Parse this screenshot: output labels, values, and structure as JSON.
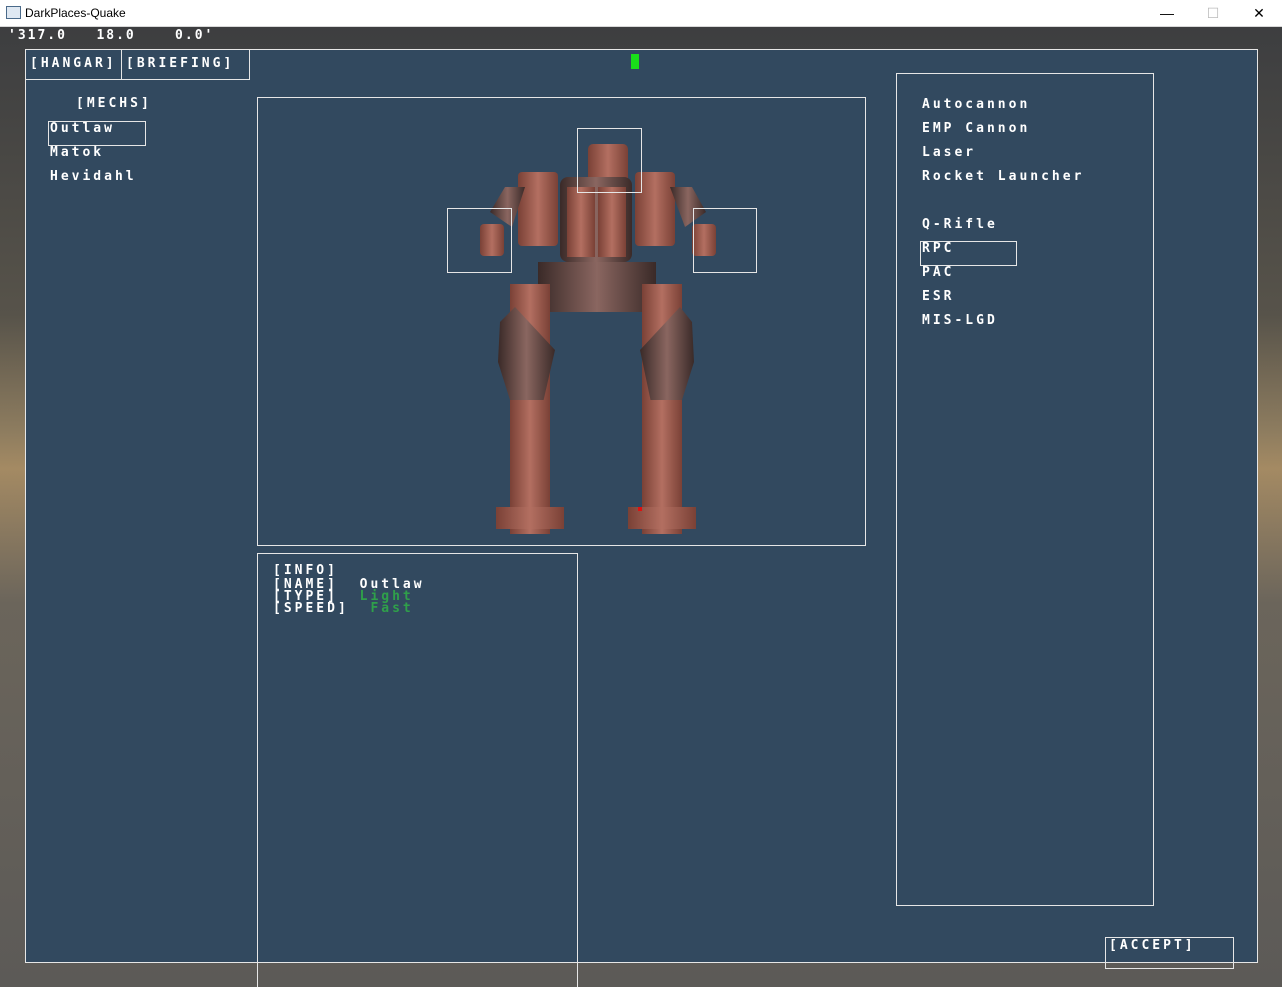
{
  "window": {
    "title": "DarkPlaces-Quake",
    "minimize_glyph": "—",
    "maximize_glyph": "☐",
    "close_glyph": "✕"
  },
  "hud": {
    "coords": "'317.0   18.0    0.0'"
  },
  "tabs": {
    "hangar": "[HANGAR]",
    "briefing": "[BRIEFING]"
  },
  "mechs": {
    "header": "[MECHS]",
    "items": [
      "Outlaw",
      "Matok",
      "Hevidahl"
    ],
    "selected": "Outlaw"
  },
  "weapons": {
    "items": [
      "Autocannon",
      "EMP Cannon",
      "Laser",
      "Rocket Launcher",
      "Q-Rifle",
      "RPC",
      "PAC",
      "ESR",
      "MIS-LGD"
    ],
    "selected": "RPC"
  },
  "info": {
    "header": "[INFO]",
    "name_label": "[NAME]",
    "name_value": "Outlaw",
    "type_label": "[TYPE]",
    "type_value": "Light",
    "speed_label": "[SPEED]",
    "speed_value": "Fast"
  },
  "accept": "[ACCEPT]",
  "colors": {
    "panel": "#32495f",
    "accent_green": "#2fa04a",
    "indicator": "#19e019",
    "mech_rust": "#a7665a"
  }
}
